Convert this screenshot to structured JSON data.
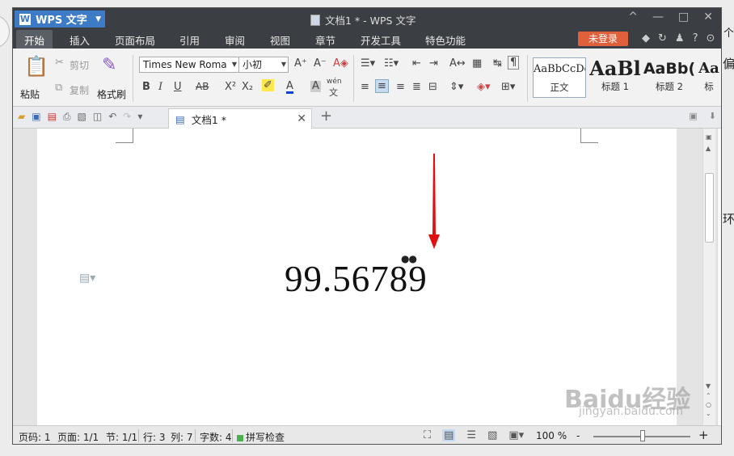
{
  "window": {
    "app_button": "WPS 文字",
    "title": "文档1 * - WPS 文字",
    "controls": [
      "^",
      "—",
      "□",
      "✕"
    ]
  },
  "menu": {
    "tabs": [
      "开始",
      "插入",
      "页面布局",
      "引用",
      "审阅",
      "视图",
      "章节",
      "开发工具",
      "特色功能"
    ],
    "login": "未登录",
    "help": "?"
  },
  "ribbon": {
    "paste": "粘贴",
    "cut": "剪切",
    "copy": "复制",
    "format_painter": "格式刷",
    "font_name": "Times New Roma",
    "font_size": "小初",
    "bold": "B",
    "italic": "I",
    "underline": "U",
    "strike": "AB",
    "superscript": "X²",
    "subscript": "X₂",
    "font_color": "A",
    "char_shading": "A",
    "phonetic": "wén",
    "phonetic_char": "文",
    "styles": [
      {
        "preview": "AaBbCcDd",
        "name": "正文"
      },
      {
        "preview": "AaBl",
        "name": "标题 1"
      },
      {
        "preview": "AaBb(",
        "name": "标题 2"
      },
      {
        "preview": "Aa",
        "name": "标"
      }
    ]
  },
  "tabs": {
    "doc_tab": "文档1 *",
    "close": "✕",
    "new": "+"
  },
  "document": {
    "content": "99.56789",
    "dots": "●●"
  },
  "status": {
    "page_num": "页码: 1",
    "pages": "页面: 1/1",
    "section": "节: 1/1",
    "row": "行: 3",
    "col": "列: 7",
    "words": "字数: 4",
    "spell": "拼写检查",
    "zoom": "100 %",
    "zoom_minus": "-",
    "zoom_plus": "+"
  },
  "outside": {
    "t1": "个",
    "t2": "偏",
    "t3": "环"
  },
  "watermark": {
    "brand": "Baidu经验",
    "url": "jingyan.baidu.com"
  },
  "colors": {
    "titlebar": "#3b3f44",
    "accent": "#3d7bc6",
    "login": "#e0603c",
    "arrow": "#e01010"
  }
}
